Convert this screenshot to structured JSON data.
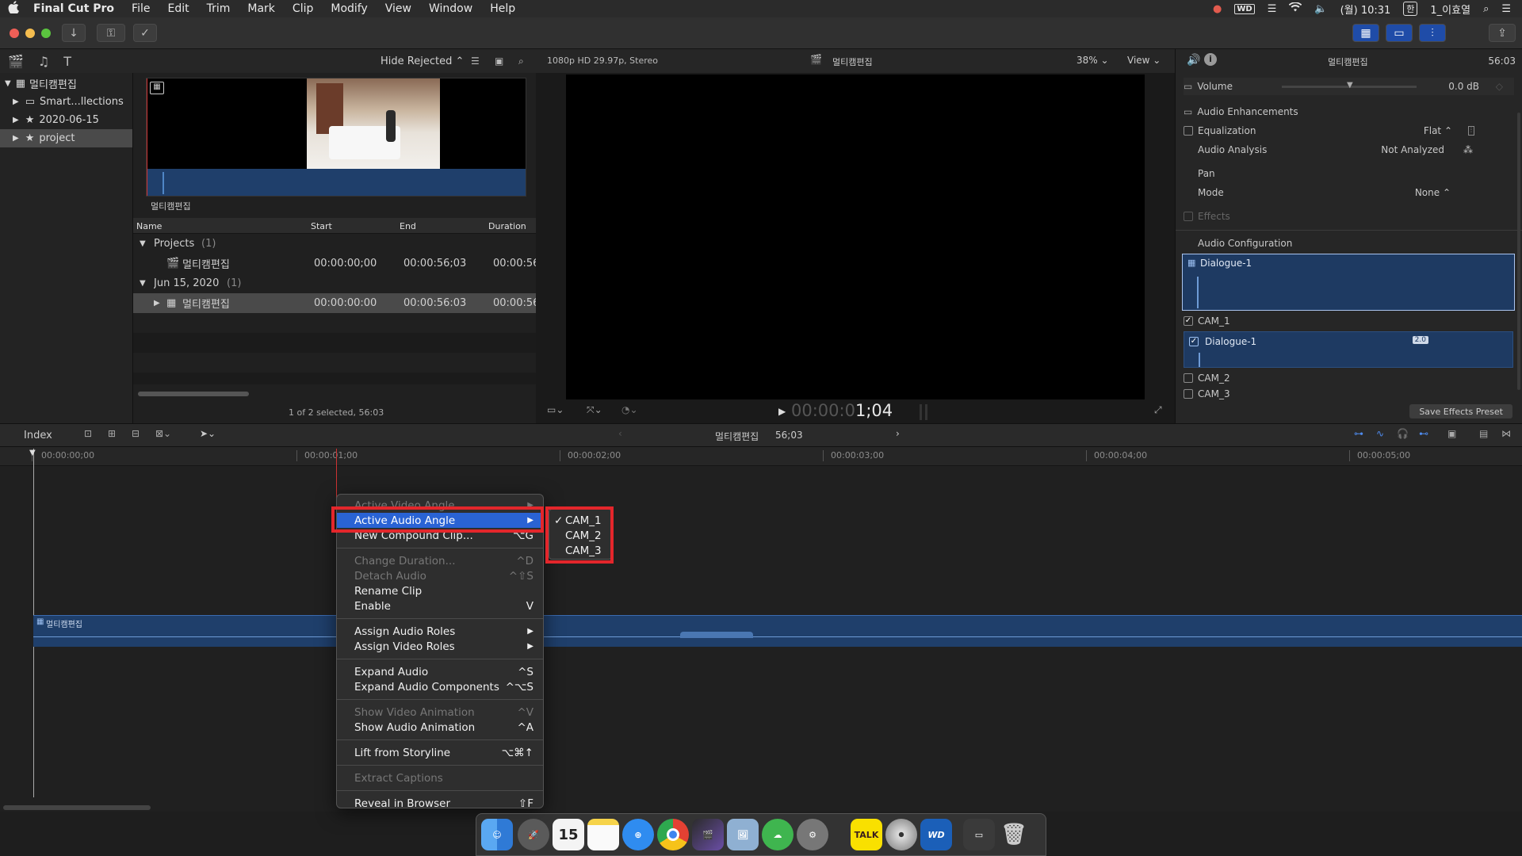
{
  "menubar": {
    "apple": "",
    "app_name": "Final Cut Pro",
    "items": [
      "File",
      "Edit",
      "Trim",
      "Mark",
      "Clip",
      "Modify",
      "View",
      "Window",
      "Help"
    ],
    "wd": "WD",
    "clock": "(월) 10:31",
    "user": "1_이효열"
  },
  "library": {
    "root": "멀티캠편집",
    "items": [
      "Smart...llections",
      "2020-06-15",
      "project"
    ]
  },
  "browser": {
    "filter": "Hide Rejected",
    "thumb_label": "멀티캠편집",
    "columns": [
      "Name",
      "Start",
      "End",
      "Duration"
    ],
    "groups": [
      {
        "name": "Projects",
        "count": "(1)",
        "clip": {
          "name": "멀티캠편집",
          "start": "00:00:00;00",
          "end": "00:00:56;03",
          "duration": "00:00:56"
        }
      },
      {
        "name": "Jun 15, 2020",
        "count": "(1)",
        "clip": {
          "name": "멀티캠편집",
          "start": "00:00:00:00",
          "end": "00:00:56:03",
          "duration": "00:00:56"
        }
      }
    ],
    "status": "1 of 2 selected, 56:03"
  },
  "viewer": {
    "format": "1080p HD 29.97p, Stereo",
    "title": "멀티캠편집",
    "zoom": "38%",
    "view": "View",
    "timecode_dim": "00:00:0",
    "timecode_bright": "1;04"
  },
  "inspector": {
    "title": "멀티캠편집",
    "duration": "56:03",
    "volume_label": "Volume",
    "volume_value": "0.0 dB",
    "enhancements": "Audio Enhancements",
    "equalization": "Equalization",
    "equalization_value": "Flat",
    "analysis": "Audio Analysis",
    "analysis_value": "Not Analyzed",
    "pan": "Pan",
    "mode": "Mode",
    "mode_value": "None",
    "effects": "Effects",
    "config": "Audio Configuration",
    "dialogue_main": "Dialogue-1",
    "cam1": "CAM_1",
    "dialogue_sub": "Dialogue-1",
    "badge": "2.0",
    "cam2": "CAM_2",
    "cam3": "CAM_3",
    "save_preset": "Save Effects Preset"
  },
  "timeline": {
    "index": "Index",
    "project": "멀티캠편집",
    "duration": "56;03",
    "ticks": [
      "00:00:00;00",
      "00:00:01;00",
      "00:00:02;00",
      "00:00:03;00",
      "00:00:04;00",
      "00:00:05;00"
    ],
    "clip_label": "멀티캠편집"
  },
  "context_menu": {
    "items": [
      {
        "label": "Active Video Angle",
        "shortcut": "▶",
        "disabled": true
      },
      {
        "label": "Active Audio Angle",
        "shortcut": "▶",
        "highlight": true
      },
      {
        "label": "New Compound Clip...",
        "shortcut": "⌥G"
      },
      {
        "sep": true
      },
      {
        "label": "Change Duration...",
        "shortcut": "^D",
        "disabled": true
      },
      {
        "label": "Detach Audio",
        "shortcut": "^⇧S",
        "disabled": true
      },
      {
        "label": "Rename Clip",
        "shortcut": ""
      },
      {
        "label": "Enable",
        "shortcut": "V"
      },
      {
        "sep": true
      },
      {
        "label": "Assign Audio Roles",
        "shortcut": "▶"
      },
      {
        "label": "Assign Video Roles",
        "shortcut": "▶"
      },
      {
        "sep": true
      },
      {
        "label": "Expand Audio",
        "shortcut": "^S"
      },
      {
        "label": "Expand Audio Components",
        "shortcut": "^⌥S"
      },
      {
        "sep": true
      },
      {
        "label": "Show Video Animation",
        "shortcut": "^V",
        "disabled": true
      },
      {
        "label": "Show Audio Animation",
        "shortcut": "^A"
      },
      {
        "sep": true
      },
      {
        "label": "Lift from Storyline",
        "shortcut": "⌥⌘↑"
      },
      {
        "sep": true
      },
      {
        "label": "Extract Captions",
        "shortcut": "",
        "disabled": true
      },
      {
        "sep": true
      },
      {
        "label": "Reveal in Browser",
        "shortcut": "⇧F"
      }
    ]
  },
  "submenu": {
    "check": "✓",
    "items": [
      "CAM_1",
      "CAM_2",
      "CAM_3"
    ]
  },
  "dock": {
    "calendar_day": "15",
    "talk": "TALK",
    "wd": "WD"
  },
  "colors": {
    "accent": "#2a63d4",
    "highlight_box": "#e3262b",
    "clip_blue": "#1f3f6b"
  }
}
